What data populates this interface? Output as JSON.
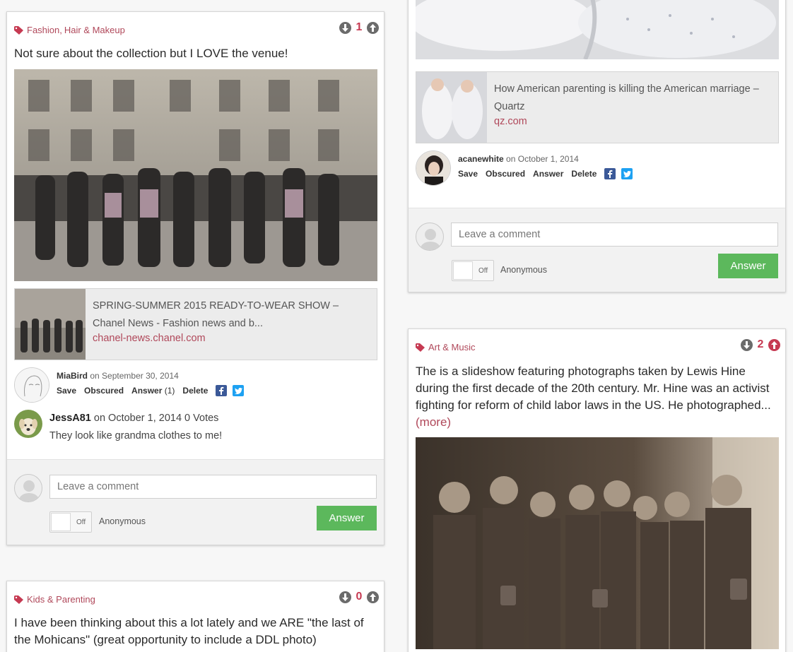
{
  "colors": {
    "accent": "#b0485a",
    "vote_red": "#c63a52",
    "answer_green": "#5cb85c",
    "facebook": "#3b5998",
    "twitter": "#1da1f2"
  },
  "post1": {
    "tags": [
      "Fashion",
      "Hair & Makeup"
    ],
    "tag_sep": ",",
    "vote_count": "1",
    "title": "Not sure about the collection but I LOVE the venue!",
    "link": {
      "title": "SPRING-SUMMER 2015 READY-TO-WEAR SHOW – Chanel News - Fashion news and b...",
      "domain": "chanel-news.chanel.com"
    },
    "author": {
      "name": "MiaBird",
      "date_text": "on September 30, 2014"
    },
    "actions": {
      "save": "Save",
      "obscured": "Obscured",
      "answer": "Answer",
      "answer_count": "(1)",
      "delete": "Delete"
    },
    "comment": {
      "name": "JessA81",
      "date_text": "on October 1, 2014 0 Votes",
      "text": "They look like grandma clothes to me!"
    },
    "reply": {
      "placeholder": "Leave a comment",
      "toggle_off": "Off",
      "anonymous": "Anonymous",
      "answer_button": "Answer"
    }
  },
  "post2": {
    "link": {
      "title": "How American parenting is killing the American marriage – Quartz",
      "domain": "qz.com"
    },
    "author": {
      "name": "acanewhite",
      "date_text": "on October 1, 2014"
    },
    "actions": {
      "save": "Save",
      "obscured": "Obscured",
      "answer": "Answer",
      "delete": "Delete"
    },
    "reply": {
      "placeholder": "Leave a comment",
      "toggle_off": "Off",
      "anonymous": "Anonymous",
      "answer_button": "Answer"
    }
  },
  "post3": {
    "tags": [
      "Kids & Parenting"
    ],
    "vote_count": "0",
    "title": "I have been thinking about this a lot lately and we ARE \"the last of the Mohicans\" (great opportunity to include a DDL photo)"
  },
  "post4": {
    "tags": [
      "Art & Music"
    ],
    "vote_count": "2",
    "text": "The is a slideshow featuring photographs taken by Lewis Hine during the first decade of the 20th century. Mr. Hine was an activist fighting for reform of child labor laws in the US. He photographed...",
    "more": "(more)"
  }
}
